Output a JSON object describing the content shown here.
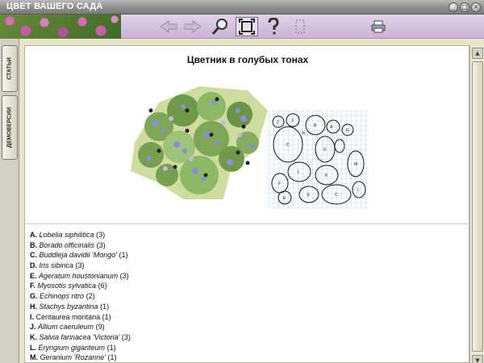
{
  "window": {
    "title": "ЦВЕТ ВАШЕГО САДА"
  },
  "window_controls": [
    "_",
    "□",
    "×"
  ],
  "side_tabs": [
    {
      "label": "СТАТЬИ"
    },
    {
      "label": "ДЕМОВЕРСИИ"
    }
  ],
  "content": {
    "heading": "Цветник в голубых тонах",
    "plants": [
      {
        "letter": "A.",
        "latin": "Lobelia siphilitica",
        "count": "(3)"
      },
      {
        "letter": "B.",
        "latin": "Borado officinalis",
        "count": "(3)"
      },
      {
        "letter": "C.",
        "latin": "Buddleja davidii 'Mongo'",
        "count": "(1)"
      },
      {
        "letter": "D.",
        "latin": "Iris sibirica",
        "count": "(3)"
      },
      {
        "letter": "E.",
        "latin": "Ageratum houstonianum",
        "count": "(3)"
      },
      {
        "letter": "F.",
        "latin": "Myosotis sylvatica",
        "count": "(6)"
      },
      {
        "letter": "G.",
        "latin": "Echinops ritro",
        "count": "(2)"
      },
      {
        "letter": "H.",
        "latin": "Stachys byzantina",
        "count": "(1)"
      },
      {
        "letter": "I.",
        "latin": "Centaurea montana",
        "count": "(1)"
      },
      {
        "letter": "J.",
        "latin": "Allium caeruleum",
        "count": "(9)"
      },
      {
        "letter": "K.",
        "latin": "Salvia farinacea 'Victoria'",
        "count": "(3)"
      },
      {
        "letter": "L.",
        "latin": "Eryngium giganteum",
        "count": "(1)"
      },
      {
        "letter": "M.",
        "latin": "Geranium 'Rozanne'",
        "count": "(1)"
      }
    ],
    "plan_labels": [
      "J",
      "J",
      "H",
      "B",
      "A",
      "C",
      "D",
      "M",
      "I",
      "K",
      "F",
      "G",
      "E",
      "E",
      "C",
      "L"
    ]
  },
  "colors": {
    "titlebar": "#8e8e8e",
    "toolbar": "#d6c3df",
    "side_panel": "#e9e3c8"
  }
}
